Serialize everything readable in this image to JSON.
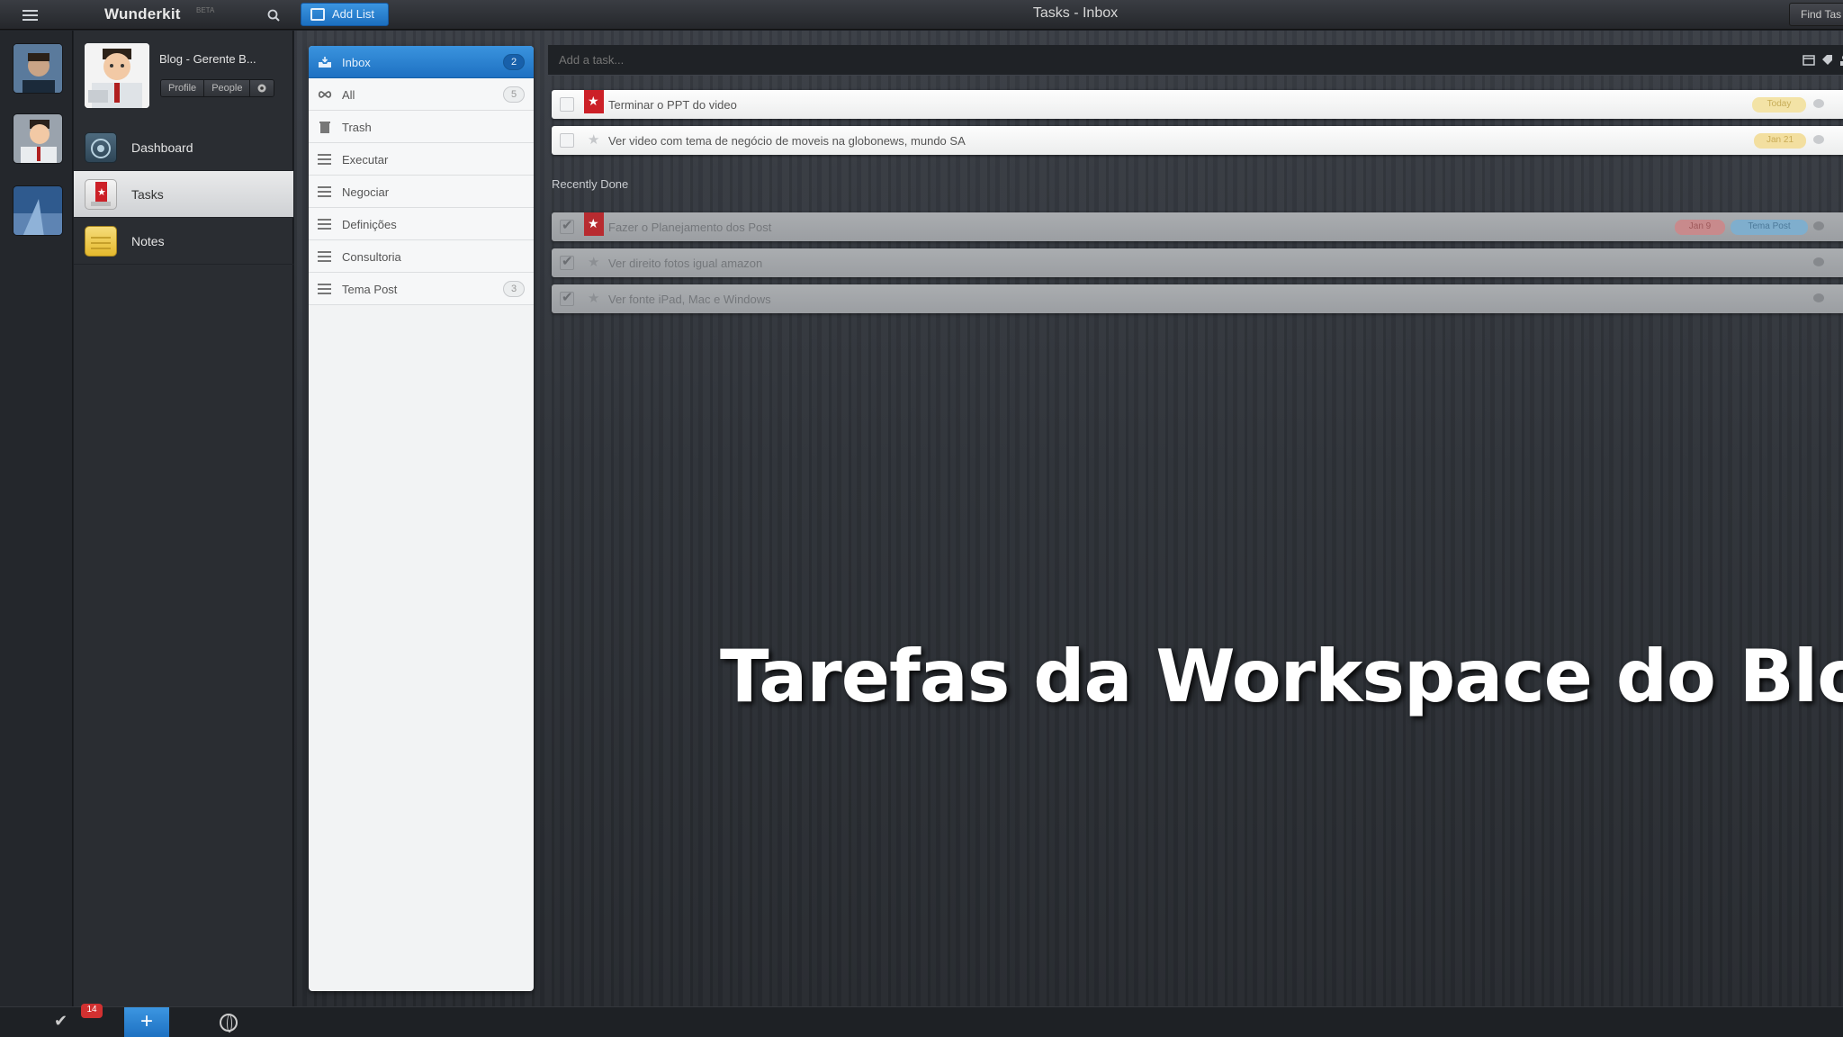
{
  "topbar": {
    "app_title": "Wunderkit",
    "app_badge": "BETA",
    "add_list_label": "Add List",
    "window_title": "Tasks - Inbox",
    "find_label": "Find Tas"
  },
  "workspaces": [
    {
      "name": "user-workspace-1",
      "icon": "avatar"
    },
    {
      "name": "user-workspace-2",
      "icon": "avatar"
    },
    {
      "name": "user-workspace-3",
      "icon": "landscape"
    }
  ],
  "profile": {
    "name": "Blog - Gerente B...",
    "profile_label": "Profile",
    "people_label": "People",
    "settings_icon": "gear-icon"
  },
  "nav": {
    "items": [
      {
        "label": "Dashboard",
        "icon": "dashboard-icon"
      },
      {
        "label": "Tasks",
        "icon": "tasks-icon",
        "active": true
      },
      {
        "label": "Notes",
        "icon": "notes-icon"
      }
    ]
  },
  "lists": [
    {
      "label": "Inbox",
      "count": "2",
      "icon": "inbox-icon",
      "active": true
    },
    {
      "label": "All",
      "count": "5",
      "icon": "infinity-icon"
    },
    {
      "label": "Trash",
      "count": "",
      "icon": "trash-icon"
    },
    {
      "label": "Executar",
      "count": "",
      "icon": "list-icon"
    },
    {
      "label": "Negociar",
      "count": "",
      "icon": "list-icon"
    },
    {
      "label": "Definições",
      "count": "",
      "icon": "list-icon"
    },
    {
      "label": "Consultoria",
      "count": "",
      "icon": "list-icon"
    },
    {
      "label": "Tema Post",
      "count": "3",
      "icon": "list-icon"
    }
  ],
  "add_task": {
    "placeholder": "Add a task..."
  },
  "tasks": [
    {
      "title": "Terminar o PPT do video",
      "starred": true,
      "due": "Today",
      "done": false
    },
    {
      "title": "Ver video com tema de negócio de moveis na globonews, mundo SA",
      "starred": false,
      "due": "Jan 21",
      "done": false
    }
  ],
  "recently_done": {
    "title": "Recently Done",
    "tasks": [
      {
        "title": "Fazer o Planejamento dos Post",
        "starred": true,
        "due": "Jan 9",
        "tag": "Tema Post",
        "done": true
      },
      {
        "title": "Ver direito fotos igual amazon",
        "starred": false,
        "done": true
      },
      {
        "title": "Ver fonte iPad, Mac e Windows",
        "starred": false,
        "done": true
      }
    ]
  },
  "bottombar": {
    "badge_count": "14"
  },
  "caption": "Tarefas da Workspace do Blog",
  "colors": {
    "accent_blue": "#1e71c2",
    "star_red": "#cc2027",
    "badge_red": "#d23131",
    "today_tag": "#f3e3a6",
    "date_tag": "#f3dfa0"
  }
}
